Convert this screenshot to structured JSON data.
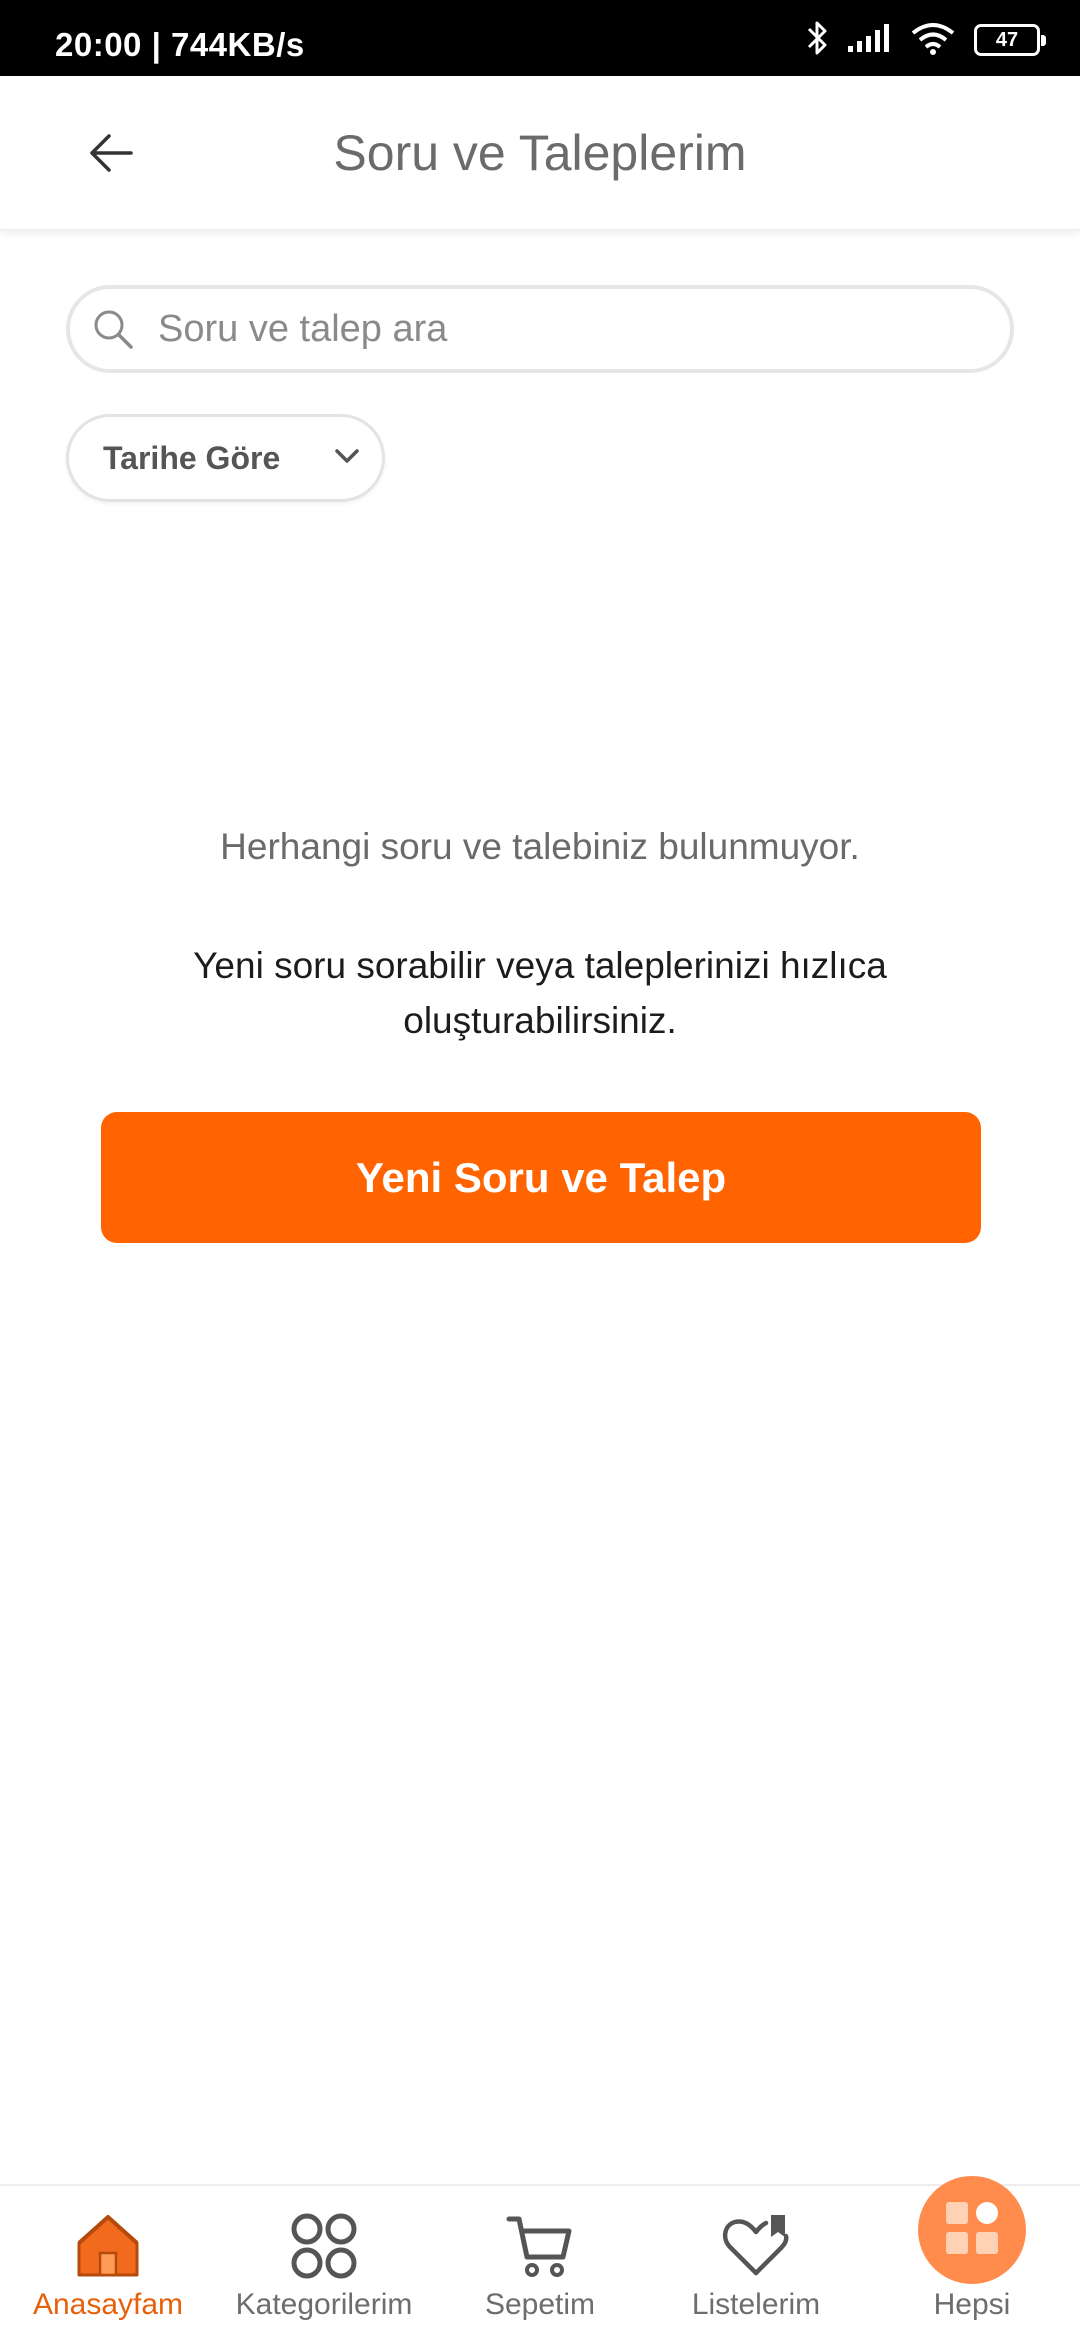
{
  "status_bar": {
    "time_speed": "20:00 | 744KB/s",
    "battery": "47",
    "icons": [
      "bluetooth-icon",
      "signal-icon",
      "wifi-icon",
      "battery-icon"
    ]
  },
  "header": {
    "title": "Soru ve Taleplerim",
    "back_icon": "arrow-left-icon"
  },
  "search": {
    "placeholder": "Soru ve talep ara",
    "value": ""
  },
  "sort": {
    "selected": "Tarihe Göre"
  },
  "empty_state": {
    "title": "Herhangi soru ve talebiniz bulunmuyor.",
    "description": "Yeni soru sorabilir veya taleplerinizi hızlıca oluşturabilirsiniz.",
    "button_label": "Yeni Soru ve Talep"
  },
  "bottom_nav": {
    "items": [
      {
        "label": "Anasayfam",
        "icon": "home-icon",
        "active": true
      },
      {
        "label": "Kategorilerim",
        "icon": "categories-icon",
        "active": false
      },
      {
        "label": "Sepetim",
        "icon": "cart-icon",
        "active": false
      },
      {
        "label": "Listelerim",
        "icon": "heart-list-icon",
        "active": false
      },
      {
        "label": "Hepsi",
        "icon": "grid-apps-icon",
        "active": false
      }
    ]
  },
  "colors": {
    "accent": "#ff6400",
    "active_nav": "#e8600a",
    "hepsi_badge": "#ff8c4c"
  }
}
